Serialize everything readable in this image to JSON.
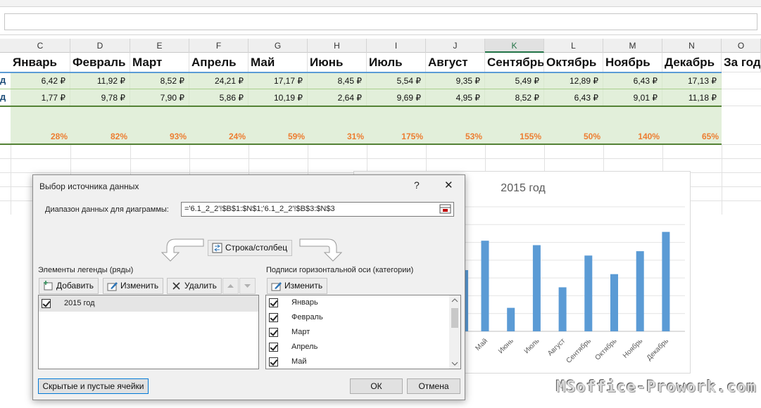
{
  "columns": [
    "C",
    "D",
    "E",
    "F",
    "G",
    "H",
    "I",
    "J",
    "K",
    "L",
    "M",
    "N",
    "O"
  ],
  "selected_column": "K",
  "months": [
    "Январь",
    "Февраль",
    "Март",
    "Апрель",
    "Май",
    "Июнь",
    "Июль",
    "Август",
    "Сентябрь",
    "Октябрь",
    "Ноябрь",
    "Декабрь",
    "За год"
  ],
  "row_label_fragment": "д",
  "rows": [
    [
      "6,42 ₽",
      "11,92 ₽",
      "8,52 ₽",
      "24,21 ₽",
      "17,17 ₽",
      "8,45 ₽",
      "5,54 ₽",
      "9,35 ₽",
      "5,49 ₽",
      "12,89 ₽",
      "6,43 ₽",
      "17,13 ₽"
    ],
    [
      "1,77 ₽",
      "9,78 ₽",
      "7,90 ₽",
      "5,86 ₽",
      "10,19 ₽",
      "2,64 ₽",
      "9,69 ₽",
      "4,95 ₽",
      "8,52 ₽",
      "6,43 ₽",
      "9,01 ₽",
      "11,18 ₽"
    ]
  ],
  "percents": [
    "28%",
    "82%",
    "93%",
    "24%",
    "59%",
    "31%",
    "175%",
    "53%",
    "155%",
    "50%",
    "140%",
    "65%"
  ],
  "chart_data": {
    "type": "bar",
    "title": "2015 год",
    "categories": [
      "Май",
      "Июнь",
      "Июль",
      "Август",
      "Сентябрь",
      "Октябрь",
      "Ноябрь",
      "Декабрь"
    ],
    "values": [
      10.19,
      2.64,
      9.69,
      4.95,
      8.52,
      6.43,
      9.01,
      11.18
    ],
    "ylim": [
      0,
      14
    ],
    "color": "#5b9bd5",
    "grid": true
  },
  "dialog": {
    "title": "Выбор источника данных",
    "help": "?",
    "close": "✕",
    "range_label": "Диапазон данных для диаграммы:",
    "range_value": "='6.1_2_2'!$B$1:$N$1;'6.1_2_2'!$B$3:$N$3",
    "switch_label": "Строка/столбец",
    "legend_title": "Элементы легенды (ряды)",
    "add": "Добавить",
    "edit": "Изменить",
    "delete": "Удалить",
    "series": [
      "2015 год"
    ],
    "axis_title": "Подписи горизонтальной оси (категории)",
    "axis_edit": "Изменить",
    "axis_items": [
      "Январь",
      "Февраль",
      "Март",
      "Апрель",
      "Май"
    ],
    "hidden_cells": "Скрытые и пустые ячейки",
    "ok": "ОК",
    "cancel": "Отмена"
  },
  "watermark": "MSoffice-Prowork.com",
  "colors": {
    "accent": "#217346",
    "bar": "#5b9bd5",
    "percent": "#ed7d31",
    "band": "#e2efda"
  }
}
